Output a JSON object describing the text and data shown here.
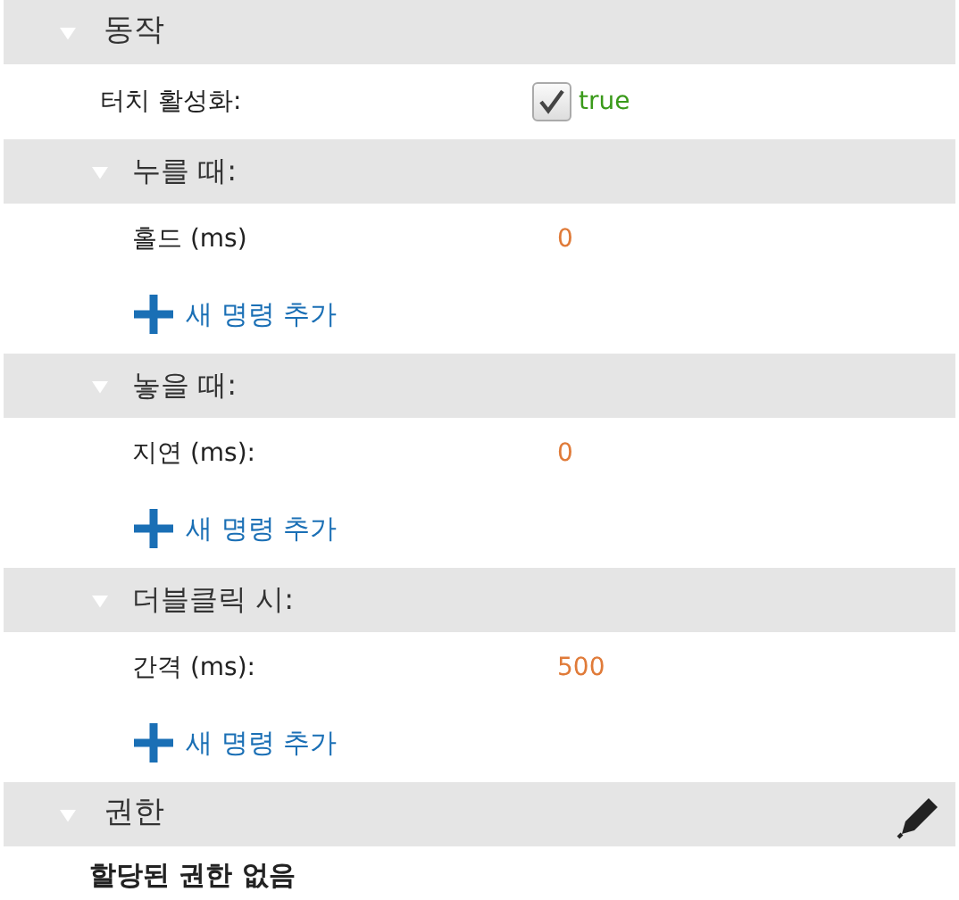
{
  "sections": [
    {
      "title": "동작",
      "expanded": true,
      "editable": false,
      "items": [
        {
          "kind": "checkbox",
          "label": "터치 활성화:",
          "checked": true,
          "value": "true"
        },
        {
          "kind": "group",
          "title": "누를 때:",
          "expanded": true,
          "items": [
            {
              "kind": "number",
              "label": "홀드 (ms)",
              "value": "0"
            },
            {
              "kind": "add",
              "label": "새 명령 추가"
            }
          ]
        },
        {
          "kind": "group",
          "title": "놓을 때:",
          "expanded": true,
          "items": [
            {
              "kind": "number",
              "label": "지연 (ms):",
              "value": "0"
            },
            {
              "kind": "add",
              "label": "새 명령 추가"
            }
          ]
        },
        {
          "kind": "group",
          "title": "더블클릭 시:",
          "expanded": true,
          "items": [
            {
              "kind": "number",
              "label": "간격 (ms):",
              "value": "500"
            },
            {
              "kind": "add",
              "label": "새 명령 추가"
            }
          ]
        }
      ]
    },
    {
      "title": "권한",
      "expanded": true,
      "editable": true,
      "items": [
        {
          "kind": "note",
          "label": "할당된 권한 없음"
        }
      ]
    }
  ]
}
